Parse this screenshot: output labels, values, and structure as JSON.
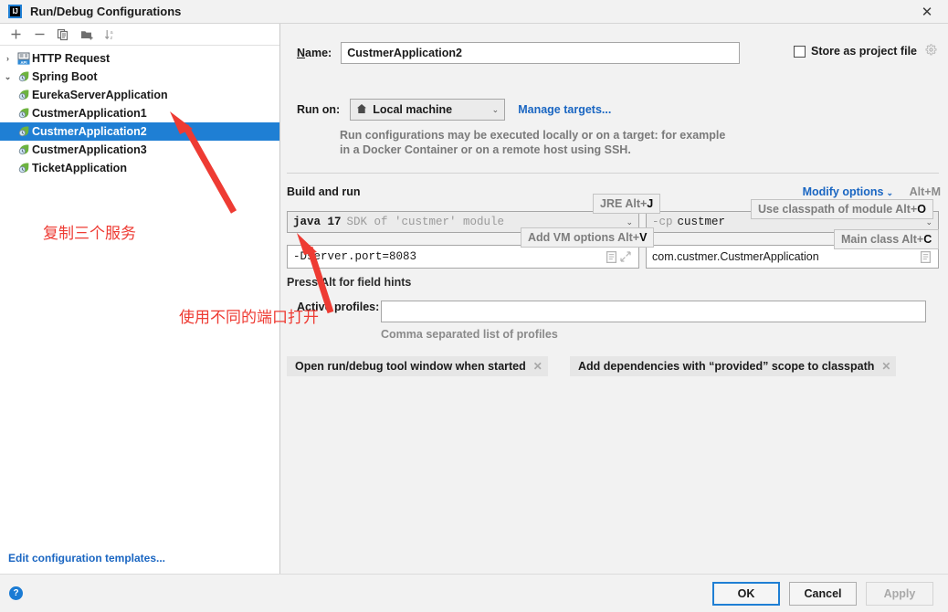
{
  "window": {
    "title": "Run/Debug Configurations",
    "logo_text": "IJ",
    "close_icon": "✕"
  },
  "left_panel": {
    "toolbar": [
      {
        "name": "add-configuration-button",
        "icon": "plus-icon"
      },
      {
        "name": "remove-configuration-button",
        "icon": "minus-icon"
      },
      {
        "name": "copy-configuration-button",
        "icon": "copy-icon"
      },
      {
        "name": "new-folder-button",
        "icon": "folder-add-icon"
      },
      {
        "name": "sort-configurations-button",
        "icon": "sort-az-icon"
      }
    ],
    "tree": [
      {
        "label": "HTTP Request",
        "level": 0,
        "twisty": "›",
        "icon": "api-icon",
        "selected": false
      },
      {
        "label": "Spring Boot",
        "level": 0,
        "twisty": "⌄",
        "icon": "spring-icon",
        "selected": false
      },
      {
        "label": "EurekaServerApplication",
        "level": 1,
        "twisty": "",
        "icon": "spring-icon",
        "selected": false
      },
      {
        "label": "CustmerApplication1",
        "level": 1,
        "twisty": "",
        "icon": "spring-icon",
        "selected": false
      },
      {
        "label": "CustmerApplication2",
        "level": 1,
        "twisty": "",
        "icon": "spring-icon",
        "selected": true
      },
      {
        "label": "CustmerApplication3",
        "level": 1,
        "twisty": "",
        "icon": "spring-icon",
        "selected": false
      },
      {
        "label": "TicketApplication",
        "level": 1,
        "twisty": "",
        "icon": "spring-icon",
        "selected": false
      }
    ],
    "edit_templates_link": "Edit configuration templates..."
  },
  "form": {
    "name_label": "Name:",
    "name_label_mnemonic": "N",
    "name_value": "CustmerApplication2",
    "store_as_project_file_label": "Store as project file",
    "store_as_project_file_checked": false,
    "store_gear_icon": "gear-icon",
    "run_on_label": "Run on:",
    "run_on_value": "Local machine",
    "run_on_icon": "local-machine-icon",
    "manage_targets_link": "Manage targets...",
    "run_on_description": "Run configurations may be executed locally or on a target: for example in a Docker Container or on a remote host using SSH.",
    "build_and_run_title": "Build and run",
    "modify_options_link": "Modify options",
    "modify_options_shortcut": "Alt+M",
    "sdk_java": "java 17",
    "sdk_description": "SDK of 'custmer' module",
    "classpath_prefix": "-cp",
    "classpath_value": "custmer",
    "vm_options_value": "-Dserver.port=8083",
    "main_class_value": "com.custmer.CustmerApplication",
    "press_alt_hint": "Press Alt for field hints",
    "active_profiles_label": "Active profiles:",
    "active_profiles_value": "",
    "active_profiles_description": "Comma separated list of profiles",
    "chips": [
      {
        "label": "Open run/debug tool window when started",
        "close": "✕"
      },
      {
        "label": "Add dependencies with “provided” scope to classpath",
        "close": "✕"
      }
    ]
  },
  "hints": [
    {
      "name": "jre-hint",
      "text": "JRE Alt+",
      "key": "J"
    },
    {
      "name": "vm-options-hint",
      "text": "Add VM options Alt+",
      "key": "V"
    },
    {
      "name": "classpath-hint",
      "text": "Use classpath of module Alt+",
      "key": "O"
    },
    {
      "name": "main-class-hint",
      "text": "Main class Alt+",
      "key": "C"
    }
  ],
  "bottom_bar": {
    "help_icon": "?",
    "ok_label": "OK",
    "cancel_label": "Cancel",
    "apply_label": "Apply",
    "apply_disabled": true
  },
  "annotations": [
    {
      "name": "annotation-copy-three-services",
      "text": "复制三个服务"
    },
    {
      "name": "annotation-use-different-ports",
      "text": "使用不同的端口打开"
    }
  ],
  "colors": {
    "accent": "#1f7fd4",
    "link": "#1a66c2",
    "annotation_red": "#ee3b33",
    "selection": "#1f7fd4"
  }
}
